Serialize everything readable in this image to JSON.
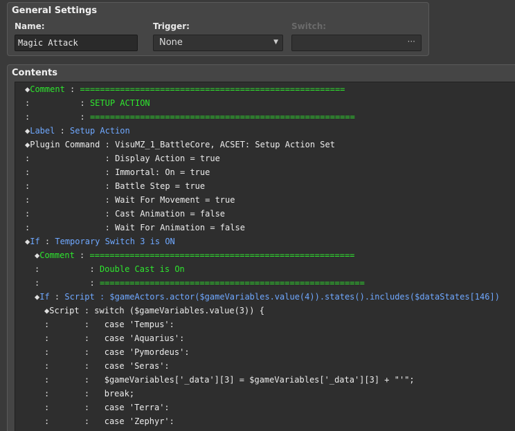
{
  "general": {
    "title": "General Settings",
    "name_label": "Name:",
    "name_value": "Magic Attack",
    "trigger_label": "Trigger:",
    "trigger_value": "None",
    "switch_label": "Switch:",
    "switch_button": "···"
  },
  "contents": {
    "title": "Contents",
    "rows": [
      {
        "indent": 0,
        "mark": "◆",
        "head": "Comment",
        "hcolor": "c-green",
        "sep": " : ",
        "body": "=====================================================",
        "bcolor": "c-green"
      },
      {
        "indent": 0,
        "mark": ":",
        "head": "         ",
        "hcolor": "c-green",
        "sep": " : ",
        "body": "SETUP ACTION",
        "bcolor": "c-green"
      },
      {
        "indent": 0,
        "mark": ":",
        "head": "         ",
        "hcolor": "c-green",
        "sep": " : ",
        "body": "=====================================================",
        "bcolor": "c-green"
      },
      {
        "indent": 0,
        "mark": "◆",
        "head": "Label",
        "hcolor": "c-blue",
        "sep": " : ",
        "body": "Setup Action",
        "bcolor": "c-blue"
      },
      {
        "indent": 0,
        "mark": "◆",
        "head": "Plugin Command",
        "hcolor": "c-white",
        "sep": " : ",
        "body": "VisuMZ_1_BattleCore, ACSET: Setup Action Set",
        "bcolor": "c-white"
      },
      {
        "indent": 0,
        "mark": ":",
        "head": "              ",
        "hcolor": "c-white",
        "sep": " : ",
        "body": "Display Action = true",
        "bcolor": "c-white"
      },
      {
        "indent": 0,
        "mark": ":",
        "head": "              ",
        "hcolor": "c-white",
        "sep": " : ",
        "body": "Immortal: On = true",
        "bcolor": "c-white"
      },
      {
        "indent": 0,
        "mark": ":",
        "head": "              ",
        "hcolor": "c-white",
        "sep": " : ",
        "body": "Battle Step = true",
        "bcolor": "c-white"
      },
      {
        "indent": 0,
        "mark": ":",
        "head": "              ",
        "hcolor": "c-white",
        "sep": " : ",
        "body": "Wait For Movement = true",
        "bcolor": "c-white"
      },
      {
        "indent": 0,
        "mark": ":",
        "head": "              ",
        "hcolor": "c-white",
        "sep": " : ",
        "body": "Cast Animation = false",
        "bcolor": "c-white"
      },
      {
        "indent": 0,
        "mark": ":",
        "head": "              ",
        "hcolor": "c-white",
        "sep": " : ",
        "body": "Wait For Animation = false",
        "bcolor": "c-white"
      },
      {
        "indent": 0,
        "mark": "◆",
        "head": "If",
        "hcolor": "c-blue",
        "sep": " : ",
        "body": "Temporary Switch 3 is ON",
        "bcolor": "c-blue"
      },
      {
        "indent": 1,
        "mark": "◆",
        "head": "Comment",
        "hcolor": "c-green",
        "sep": " : ",
        "body": "=====================================================",
        "bcolor": "c-green"
      },
      {
        "indent": 1,
        "mark": ":",
        "head": "         ",
        "hcolor": "c-green",
        "sep": " : ",
        "body": "Double Cast is On",
        "bcolor": "c-green"
      },
      {
        "indent": 1,
        "mark": ":",
        "head": "         ",
        "hcolor": "c-green",
        "sep": " : ",
        "body": "=====================================================",
        "bcolor": "c-green"
      },
      {
        "indent": 1,
        "mark": "◆",
        "head": "If",
        "hcolor": "c-blue",
        "sep": " : ",
        "body": "Script : $gameActors.actor($gameVariables.value(4)).states().includes($dataStates[146])",
        "bcolor": "c-blue"
      },
      {
        "indent": 2,
        "mark": "◆",
        "head": "Script",
        "hcolor": "c-white",
        "sep": " : ",
        "body": "switch ($gameVariables.value(3)) {",
        "bcolor": "c-code"
      },
      {
        "indent": 2,
        "mark": ":",
        "head": "      ",
        "hcolor": "c-white",
        "sep": " : ",
        "body": "  case 'Tempus':",
        "bcolor": "c-code"
      },
      {
        "indent": 2,
        "mark": ":",
        "head": "      ",
        "hcolor": "c-white",
        "sep": " : ",
        "body": "  case 'Aquarius':",
        "bcolor": "c-code"
      },
      {
        "indent": 2,
        "mark": ":",
        "head": "      ",
        "hcolor": "c-white",
        "sep": " : ",
        "body": "  case 'Pymordeus':",
        "bcolor": "c-code"
      },
      {
        "indent": 2,
        "mark": ":",
        "head": "      ",
        "hcolor": "c-white",
        "sep": " : ",
        "body": "  case 'Seras':",
        "bcolor": "c-code"
      },
      {
        "indent": 2,
        "mark": ":",
        "head": "      ",
        "hcolor": "c-white",
        "sep": " : ",
        "body": "  $gameVariables['_data'][3] = $gameVariables['_data'][3] + \"'\";",
        "bcolor": "c-code"
      },
      {
        "indent": 2,
        "mark": ":",
        "head": "      ",
        "hcolor": "c-white",
        "sep": " : ",
        "body": "  break;",
        "bcolor": "c-code"
      },
      {
        "indent": 2,
        "mark": ":",
        "head": "      ",
        "hcolor": "c-white",
        "sep": " : ",
        "body": "  case 'Terra':",
        "bcolor": "c-code"
      },
      {
        "indent": 2,
        "mark": ":",
        "head": "      ",
        "hcolor": "c-white",
        "sep": " : ",
        "body": "  case 'Zephyr':",
        "bcolor": "c-code"
      }
    ]
  }
}
